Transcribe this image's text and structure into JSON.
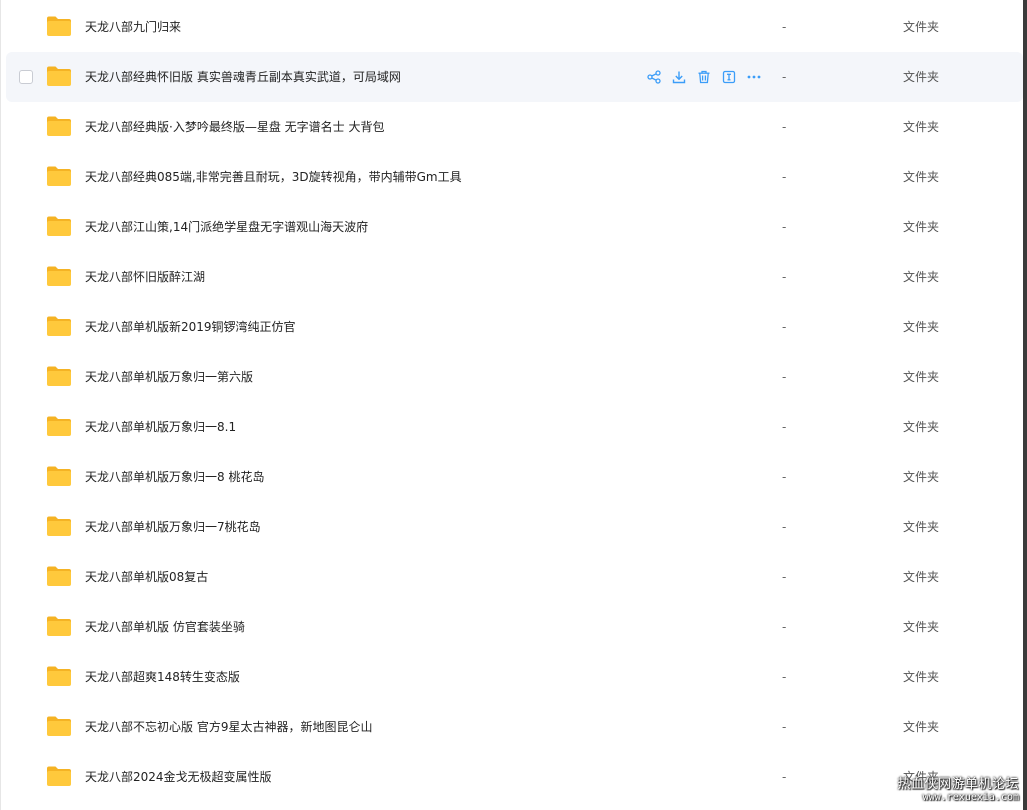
{
  "columns": {
    "size_placeholder": "-",
    "type_label": "文件夹"
  },
  "colors": {
    "folder": "#ffc93c",
    "folder_dark": "#f5b324",
    "action_icon": "#3b9df8",
    "hover_row": "#f4f6fa"
  },
  "hover_row_index": 1,
  "actions": [
    {
      "name": "share-icon"
    },
    {
      "name": "download-icon"
    },
    {
      "name": "delete-icon"
    },
    {
      "name": "rename-icon"
    },
    {
      "name": "more-icon"
    }
  ],
  "files": [
    {
      "name": "天龙八部九门归来",
      "size": "-",
      "type": "文件夹"
    },
    {
      "name": "天龙八部经典怀旧版 真实兽魂青丘副本真实武道，可局域网",
      "size": "-",
      "type": "文件夹"
    },
    {
      "name": "天龙八部经典版·入梦吟最终版—星盘 无字谱名士 大背包",
      "size": "-",
      "type": "文件夹"
    },
    {
      "name": "天龙八部经典085端,非常完善且耐玩，3D旋转视角，带内辅带Gm工具",
      "size": "-",
      "type": "文件夹"
    },
    {
      "name": "天龙八部江山策,14门派绝学星盘无字谱观山海天波府",
      "size": "-",
      "type": "文件夹"
    },
    {
      "name": "天龙八部怀旧版醉江湖",
      "size": "-",
      "type": "文件夹"
    },
    {
      "name": "天龙八部单机版新2019铜锣湾纯正仿官",
      "size": "-",
      "type": "文件夹"
    },
    {
      "name": "天龙八部单机版万象归一第六版",
      "size": "-",
      "type": "文件夹"
    },
    {
      "name": "天龙八部单机版万象归一8.1",
      "size": "-",
      "type": "文件夹"
    },
    {
      "name": "天龙八部单机版万象归一8 桃花岛",
      "size": "-",
      "type": "文件夹"
    },
    {
      "name": "天龙八部单机版万象归一7桃花岛",
      "size": "-",
      "type": "文件夹"
    },
    {
      "name": "天龙八部单机版08复古",
      "size": "-",
      "type": "文件夹"
    },
    {
      "name": "天龙八部单机版 仿官套装坐骑",
      "size": "-",
      "type": "文件夹"
    },
    {
      "name": "天龙八部超爽148转生变态版",
      "size": "-",
      "type": "文件夹"
    },
    {
      "name": "天龙八部不忘初心版 官方9星太古神器，新地图昆仑山",
      "size": "-",
      "type": "文件夹"
    },
    {
      "name": "天龙八部2024金戈无极超变属性版",
      "size": "-",
      "type": "文件夹"
    }
  ],
  "watermark": {
    "cn": "热血侠网游单机论坛",
    "url": "www.rexuexia.com"
  }
}
